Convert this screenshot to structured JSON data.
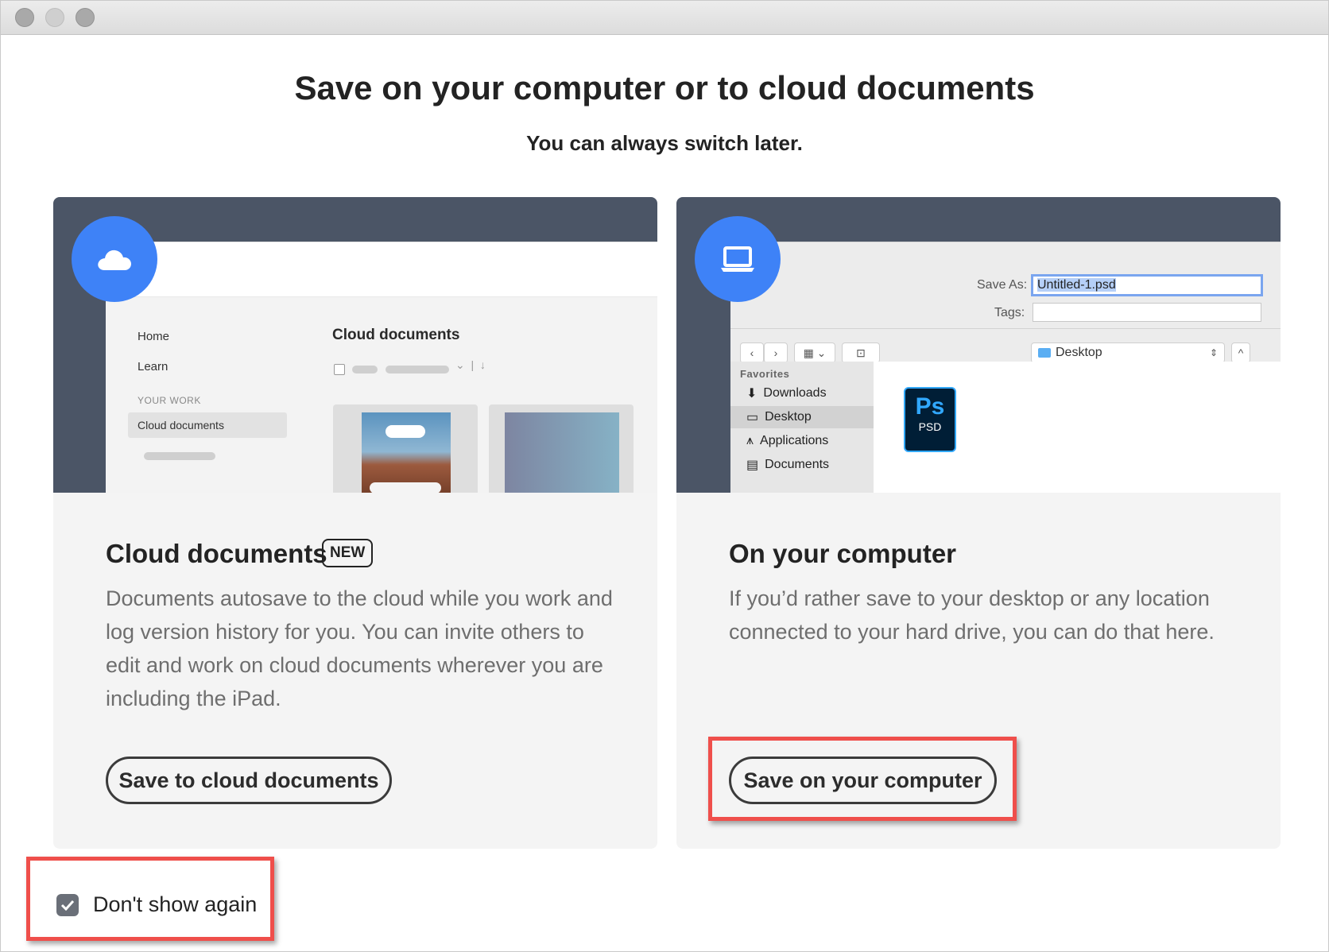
{
  "dialog": {
    "title": "Save on your computer or to cloud documents",
    "subtitle": "You can always switch later."
  },
  "cloud_card": {
    "title": "Cloud documents",
    "badge": "NEW",
    "description": "Documents autosave to the cloud while you work and log version history for you. You can invite others to edit and work on cloud documents wherever you are including the iPad.",
    "button_label": "Save to cloud documents",
    "mockup": {
      "nav_home": "Home",
      "nav_learn": "Learn",
      "section": "YOUR WORK",
      "nav_cloud": "Cloud documents",
      "heading": "Cloud documents"
    }
  },
  "computer_card": {
    "title": "On your computer",
    "description": "If you’d rather save to your desktop or any location connected to your hard drive, you can do that here.",
    "button_label": "Save on your computer",
    "mockup": {
      "save_as_label": "Save As:",
      "save_as_value": "Untitled-1.psd",
      "tags_label": "Tags:",
      "location": "Desktop",
      "favorites": "Favorites",
      "items": [
        "Downloads",
        "Desktop",
        "Applications",
        "Documents"
      ],
      "file_badge": "Ps",
      "file_type": "PSD"
    }
  },
  "dont_show": {
    "label": "Don't show again",
    "checked": true
  },
  "colors": {
    "accent": "#3e82f7",
    "highlight": "#ef4f4b",
    "illustration_bg": "#4b5566"
  }
}
